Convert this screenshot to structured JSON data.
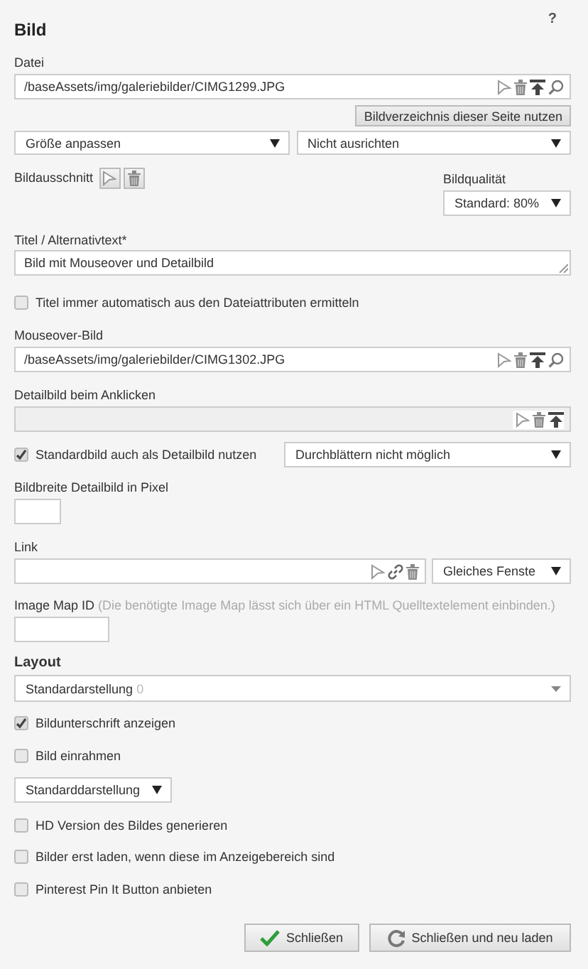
{
  "title": "Bild",
  "help": "?",
  "file": {
    "label": "Datei",
    "value": "/baseAssets/img/galeriebilder/CIMG1299.JPG"
  },
  "folder_button": "Bildverzeichnis dieser Seite nutzen",
  "size_select": "Größe anpassen",
  "align_select": "Nicht ausrichten",
  "crop": {
    "label": "Bildausschnitt"
  },
  "quality": {
    "label": "Bildqualität",
    "value": "Standard: 80%"
  },
  "title_field": {
    "label": "Titel / Alternativtext*",
    "value": "Bild mit Mouseover und Detailbild"
  },
  "auto_title": {
    "label": "Titel immer automatisch aus den Dateiattributen ermitteln",
    "checked": false
  },
  "mouseover": {
    "label": "Mouseover-Bild",
    "value": "/baseAssets/img/galeriebilder/CIMG1302.JPG"
  },
  "detail": {
    "label": "Detailbild beim Anklicken",
    "disabled": true
  },
  "use_default": {
    "label": "Standardbild auch als Detailbild nutzen",
    "checked": true
  },
  "browse_select": "Durchblättern nicht möglich",
  "detail_width": {
    "label": "Bildbreite Detailbild in Pixel"
  },
  "link": {
    "label": "Link",
    "target": "Gleiches Fenste"
  },
  "image_map": {
    "label": "Image Map ID",
    "hint": "(Die benötigte Image Map lässt sich über ein HTML Quelltextelement einbinden.)"
  },
  "layout": {
    "heading": "Layout",
    "value": "Standardarstellung",
    "count": "0"
  },
  "options": [
    {
      "label": "Bildunterschrift anzeigen",
      "checked": true
    },
    {
      "label": "Bild einrahmen",
      "checked": false
    }
  ],
  "display_select": "Standarddarstellung",
  "more_options": [
    {
      "label": "HD Version des Bildes generieren",
      "checked": false
    },
    {
      "label": "Bilder erst laden, wenn diese im Anzeigebereich sind",
      "checked": false
    },
    {
      "label": "Pinterest Pin It Button anbieten",
      "checked": false
    }
  ],
  "buttons": [
    {
      "label": "Schließen",
      "kind": "ok"
    },
    {
      "label": "Schließen und neu laden",
      "kind": "reload"
    }
  ]
}
